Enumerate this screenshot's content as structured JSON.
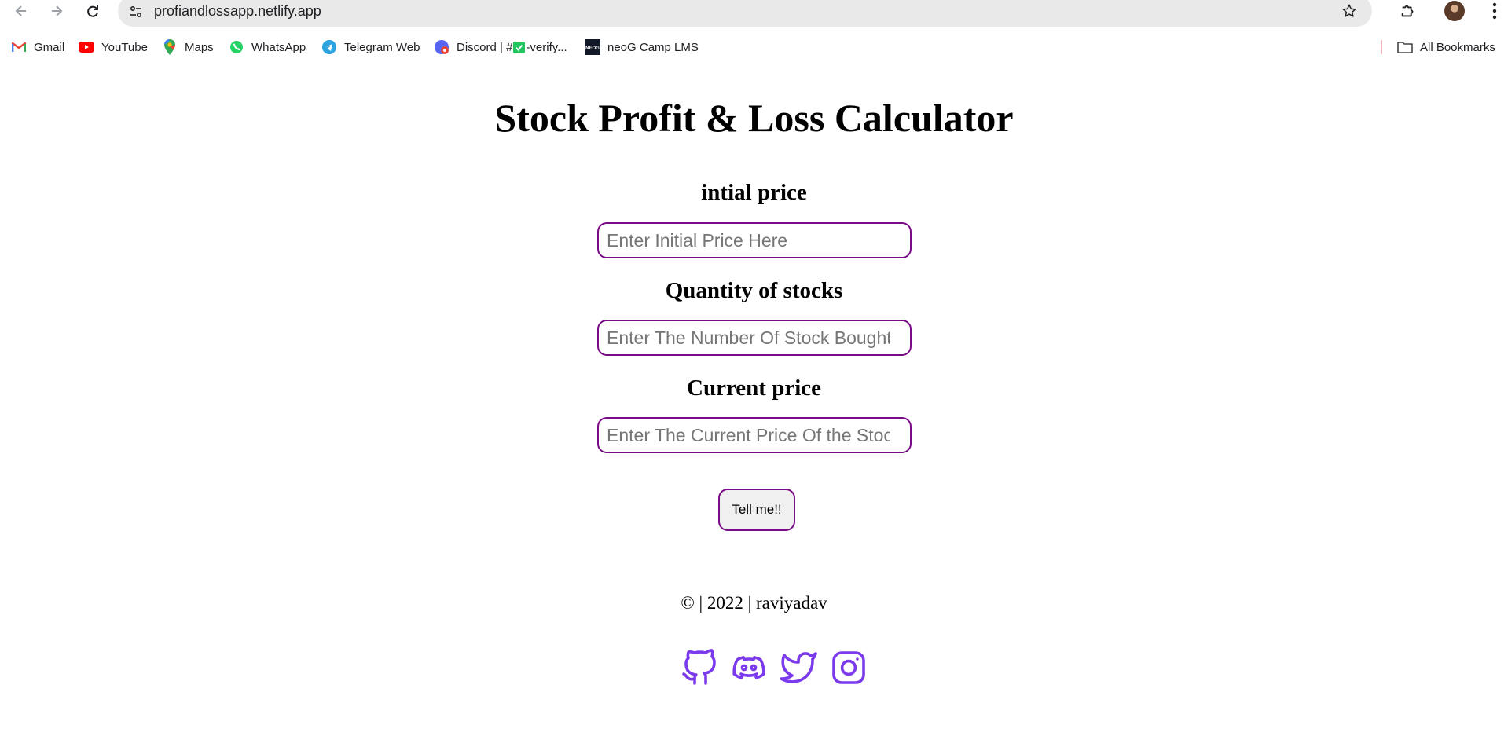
{
  "browser": {
    "url": "profiandlossapp.netlify.app",
    "bookmarks": [
      {
        "label": "Gmail",
        "icon": "gmail-icon"
      },
      {
        "label": "YouTube",
        "icon": "youtube-icon"
      },
      {
        "label": "Maps",
        "icon": "maps-icon"
      },
      {
        "label": "WhatsApp",
        "icon": "whatsapp-icon"
      },
      {
        "label": "Telegram Web",
        "icon": "telegram-icon"
      },
      {
        "label": "Discord | #",
        "label_suffix": "-verify...",
        "icon": "discord-icon"
      },
      {
        "label": "neoG Camp LMS",
        "icon": "neog-icon"
      }
    ],
    "all_bookmarks_label": "All Bookmarks"
  },
  "page": {
    "title": "Stock Profit & Loss Calculator",
    "fields": [
      {
        "label": "intial price",
        "placeholder": "Enter Initial Price Here"
      },
      {
        "label": "Quantity of stocks",
        "placeholder": "Enter The Number Of Stock Bought"
      },
      {
        "label": "Current price",
        "placeholder": "Enter The Current Price Of the Stock"
      }
    ],
    "submit_label": "Tell me!!",
    "footer": "© | 2022 | raviyadav",
    "social_icons": [
      "github-icon",
      "discord-icon",
      "twitter-icon",
      "instagram-icon"
    ]
  },
  "colors": {
    "accent": "#7a0b86",
    "social": "#7c3aed"
  }
}
